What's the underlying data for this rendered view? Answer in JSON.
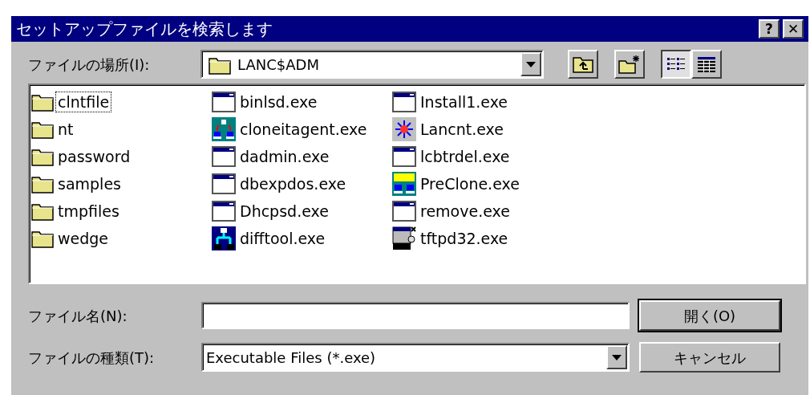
{
  "window": {
    "title": "セットアップファイルを検索します",
    "title_buttons": [
      {
        "kind": "help",
        "label": "?"
      },
      {
        "kind": "close",
        "label": "✕"
      }
    ]
  },
  "look_in": {
    "label": "ファイルの場所(I):",
    "value": "LANC$ADM"
  },
  "toolbar": [
    {
      "kind": "up",
      "pressed": false
    },
    {
      "kind": "new-folder",
      "pressed": false
    },
    {
      "kind": "list",
      "pressed": true
    },
    {
      "kind": "details",
      "pressed": false
    }
  ],
  "files": [
    {
      "name": "clntfile",
      "kind": "folder",
      "focused": true
    },
    {
      "name": "nt",
      "kind": "folder",
      "focused": false
    },
    {
      "name": "password",
      "kind": "folder",
      "focused": false
    },
    {
      "name": "samples",
      "kind": "folder",
      "focused": false
    },
    {
      "name": "tmpfiles",
      "kind": "folder",
      "focused": false
    },
    {
      "name": "wedge",
      "kind": "folder",
      "focused": false
    },
    {
      "name": "binlsd.exe",
      "kind": "window",
      "focused": false
    },
    {
      "name": "cloneitagent.exe",
      "kind": "clone",
      "focused": false
    },
    {
      "name": "dadmin.exe",
      "kind": "window",
      "focused": false
    },
    {
      "name": "dbexpdos.exe",
      "kind": "window",
      "focused": false
    },
    {
      "name": "Dhcpsd.exe",
      "kind": "window",
      "focused": false
    },
    {
      "name": "difftool.exe",
      "kind": "tree",
      "focused": false
    },
    {
      "name": "Install1.exe",
      "kind": "window",
      "focused": false
    },
    {
      "name": "Lancnt.exe",
      "kind": "network",
      "focused": false
    },
    {
      "name": "lcbtrdel.exe",
      "kind": "window",
      "focused": false
    },
    {
      "name": "PreClone.exe",
      "kind": "preclone",
      "focused": false
    },
    {
      "name": "remove.exe",
      "kind": "window",
      "focused": false
    },
    {
      "name": "tftpd32.exe",
      "kind": "server",
      "focused": false
    }
  ],
  "file_name": {
    "label": "ファイル名(N):"
  },
  "file_type": {
    "label": "ファイルの種類(T):",
    "value": "Executable Files (*.exe)"
  },
  "buttons": [
    {
      "label": "開く(O)",
      "default": true
    },
    {
      "label": "キャンセル",
      "default": false
    }
  ]
}
